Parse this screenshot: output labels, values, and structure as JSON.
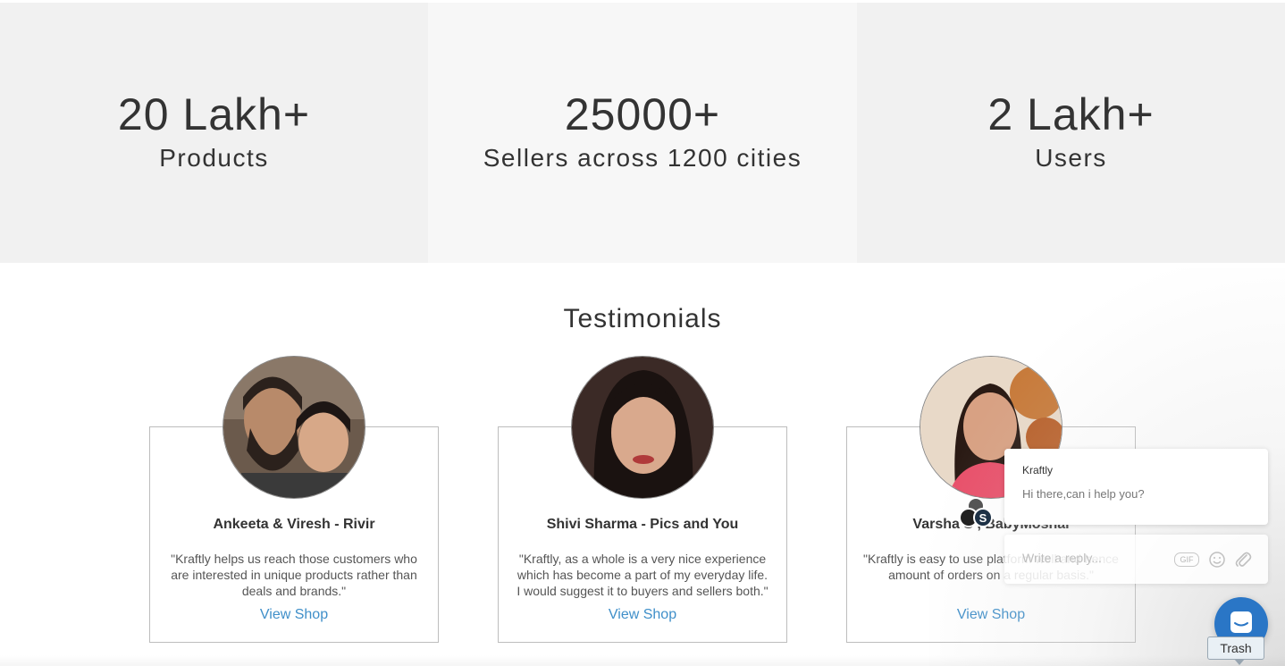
{
  "stats": [
    {
      "value": "20 Lakh+",
      "label": "Products"
    },
    {
      "value": "25000+",
      "label": "Sellers across 1200 cities"
    },
    {
      "value": "2 Lakh+",
      "label": "Users"
    }
  ],
  "testimonials": {
    "title": "Testimonials",
    "view_shop_label": "View Shop",
    "cards": [
      {
        "name": "Ankeeta & Viresh - Rivir",
        "quote": "\"Kraftly helps us reach those customers who are interested in unique products rather than deals and brands.\""
      },
      {
        "name": "Shivi Sharma - Pics and You",
        "quote": "\"Kraftly, as a whole is a very nice experience which has become a part of my everyday life. I would suggest it to buyers and sellers both.\""
      },
      {
        "name": "Varsha S , BabyMoshai",
        "quote": "\"Kraftly is easy to use platform well and hence amount of orders on a regular basis.\""
      }
    ]
  },
  "chat": {
    "sender": "Kraftly",
    "message": "Hi there,can i help you?",
    "reply_placeholder": "Write a reply...",
    "gif_label": "GIF",
    "tooltip": "Trash"
  },
  "colors": {
    "link": "#3f8fc9",
    "launcher": "#2a76c6",
    "stat_bg": "#f1f1f1"
  }
}
